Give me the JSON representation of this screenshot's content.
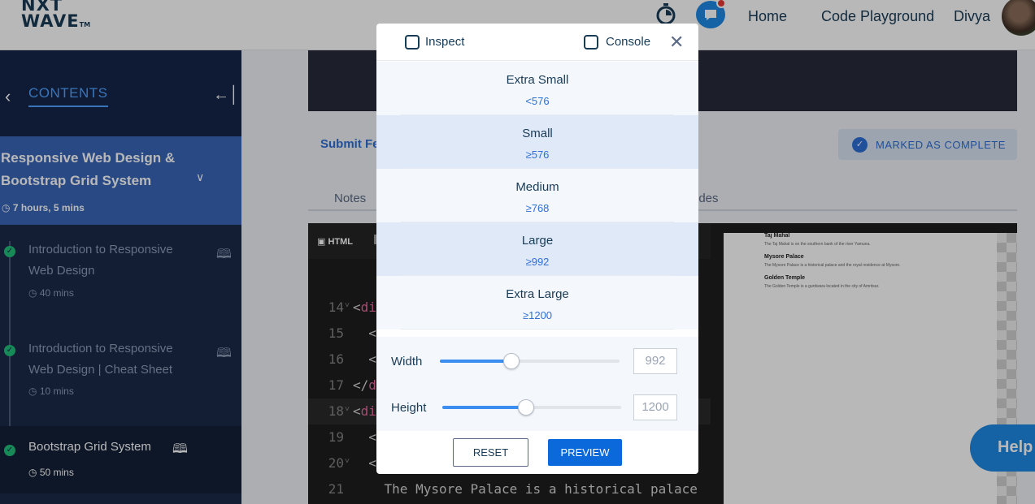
{
  "navbar": {
    "logo_line1": "NXT",
    "logo_line2": "WAVE",
    "logo_tm": "TM",
    "links": [
      "Home",
      "Code Playground"
    ],
    "user_name": "Divya"
  },
  "sidebar": {
    "back_icon": "chevron-left-icon",
    "title": "CONTENTS",
    "collapse_icon": "collapse-left-icon",
    "module": {
      "title": "Responsive Web Design & Bootstrap Grid System",
      "duration": "7 hours, 5 mins"
    },
    "items": [
      {
        "title": "Introduction to Responsive Web Design",
        "duration": "40 mins",
        "completed": true,
        "active": false
      },
      {
        "title": "Introduction to Responsive Web Design | Cheat Sheet",
        "duration": "10 mins",
        "completed": true,
        "active": false
      },
      {
        "title": "Bootstrap Grid System",
        "duration": "50 mins",
        "completed": true,
        "active": true
      }
    ]
  },
  "main": {
    "submit_feedback": "Submit Fe",
    "marked_complete": "MARKED AS COMPLETE",
    "tabs": {
      "notes": "Notes",
      "slides": "ides"
    }
  },
  "editor": {
    "tab_label": "HTML",
    "lines": [
      {
        "num": "14",
        "fold": true,
        "text": "<di",
        "highlight": false
      },
      {
        "num": "15",
        "fold": false,
        "text": "  <",
        "highlight": false
      },
      {
        "num": "16",
        "fold": false,
        "text": "  <",
        "highlight": false
      },
      {
        "num": "17",
        "fold": false,
        "text": "</d",
        "highlight": false
      },
      {
        "num": "18",
        "fold": true,
        "text": "<di",
        "highlight": true
      },
      {
        "num": "19",
        "fold": false,
        "text": "  <",
        "highlight": false
      },
      {
        "num": "20",
        "fold": true,
        "text": "  <",
        "highlight": false
      },
      {
        "num": "21",
        "fold": false,
        "text": "    The Mysore Palace is a historical palace",
        "highlight": false
      }
    ]
  },
  "preview": {
    "items": [
      {
        "heading": "Taj Mahal",
        "text": "The Taj Mahal is on the southern bank of the river Yamuna."
      },
      {
        "heading": "Mysore Palace",
        "text": "The Mysore Palace is a historical palace and the royal residence at Mysore."
      },
      {
        "heading": "Golden Temple",
        "text": "The Golden Temple is a gurdwara located in the city of Amritsar."
      }
    ]
  },
  "help_label": "Help",
  "modal": {
    "inspect_label": "Inspect",
    "console_label": "Console",
    "inspect_checked": false,
    "console_checked": false,
    "close_icon": "close-icon",
    "breakpoints": [
      {
        "name": "Extra Small",
        "value": "<576"
      },
      {
        "name": "Small",
        "value": "≥576"
      },
      {
        "name": "Medium",
        "value": "≥768"
      },
      {
        "name": "Large",
        "value": "≥992"
      },
      {
        "name": "Extra Large",
        "value": "≥1200"
      }
    ],
    "width": {
      "label": "Width",
      "value": "992",
      "fraction": 0.4
    },
    "height": {
      "label": "Height",
      "value": "1200",
      "fraction": 0.47
    },
    "reset_label": "RESET",
    "preview_label": "PREVIEW"
  },
  "colors": {
    "accent": "#2f6fd6",
    "primary_button": "#0b69dc",
    "sidebar_bg": "#1b2a4a",
    "module_bg": "#3a66b8",
    "completed": "#21c07a"
  }
}
